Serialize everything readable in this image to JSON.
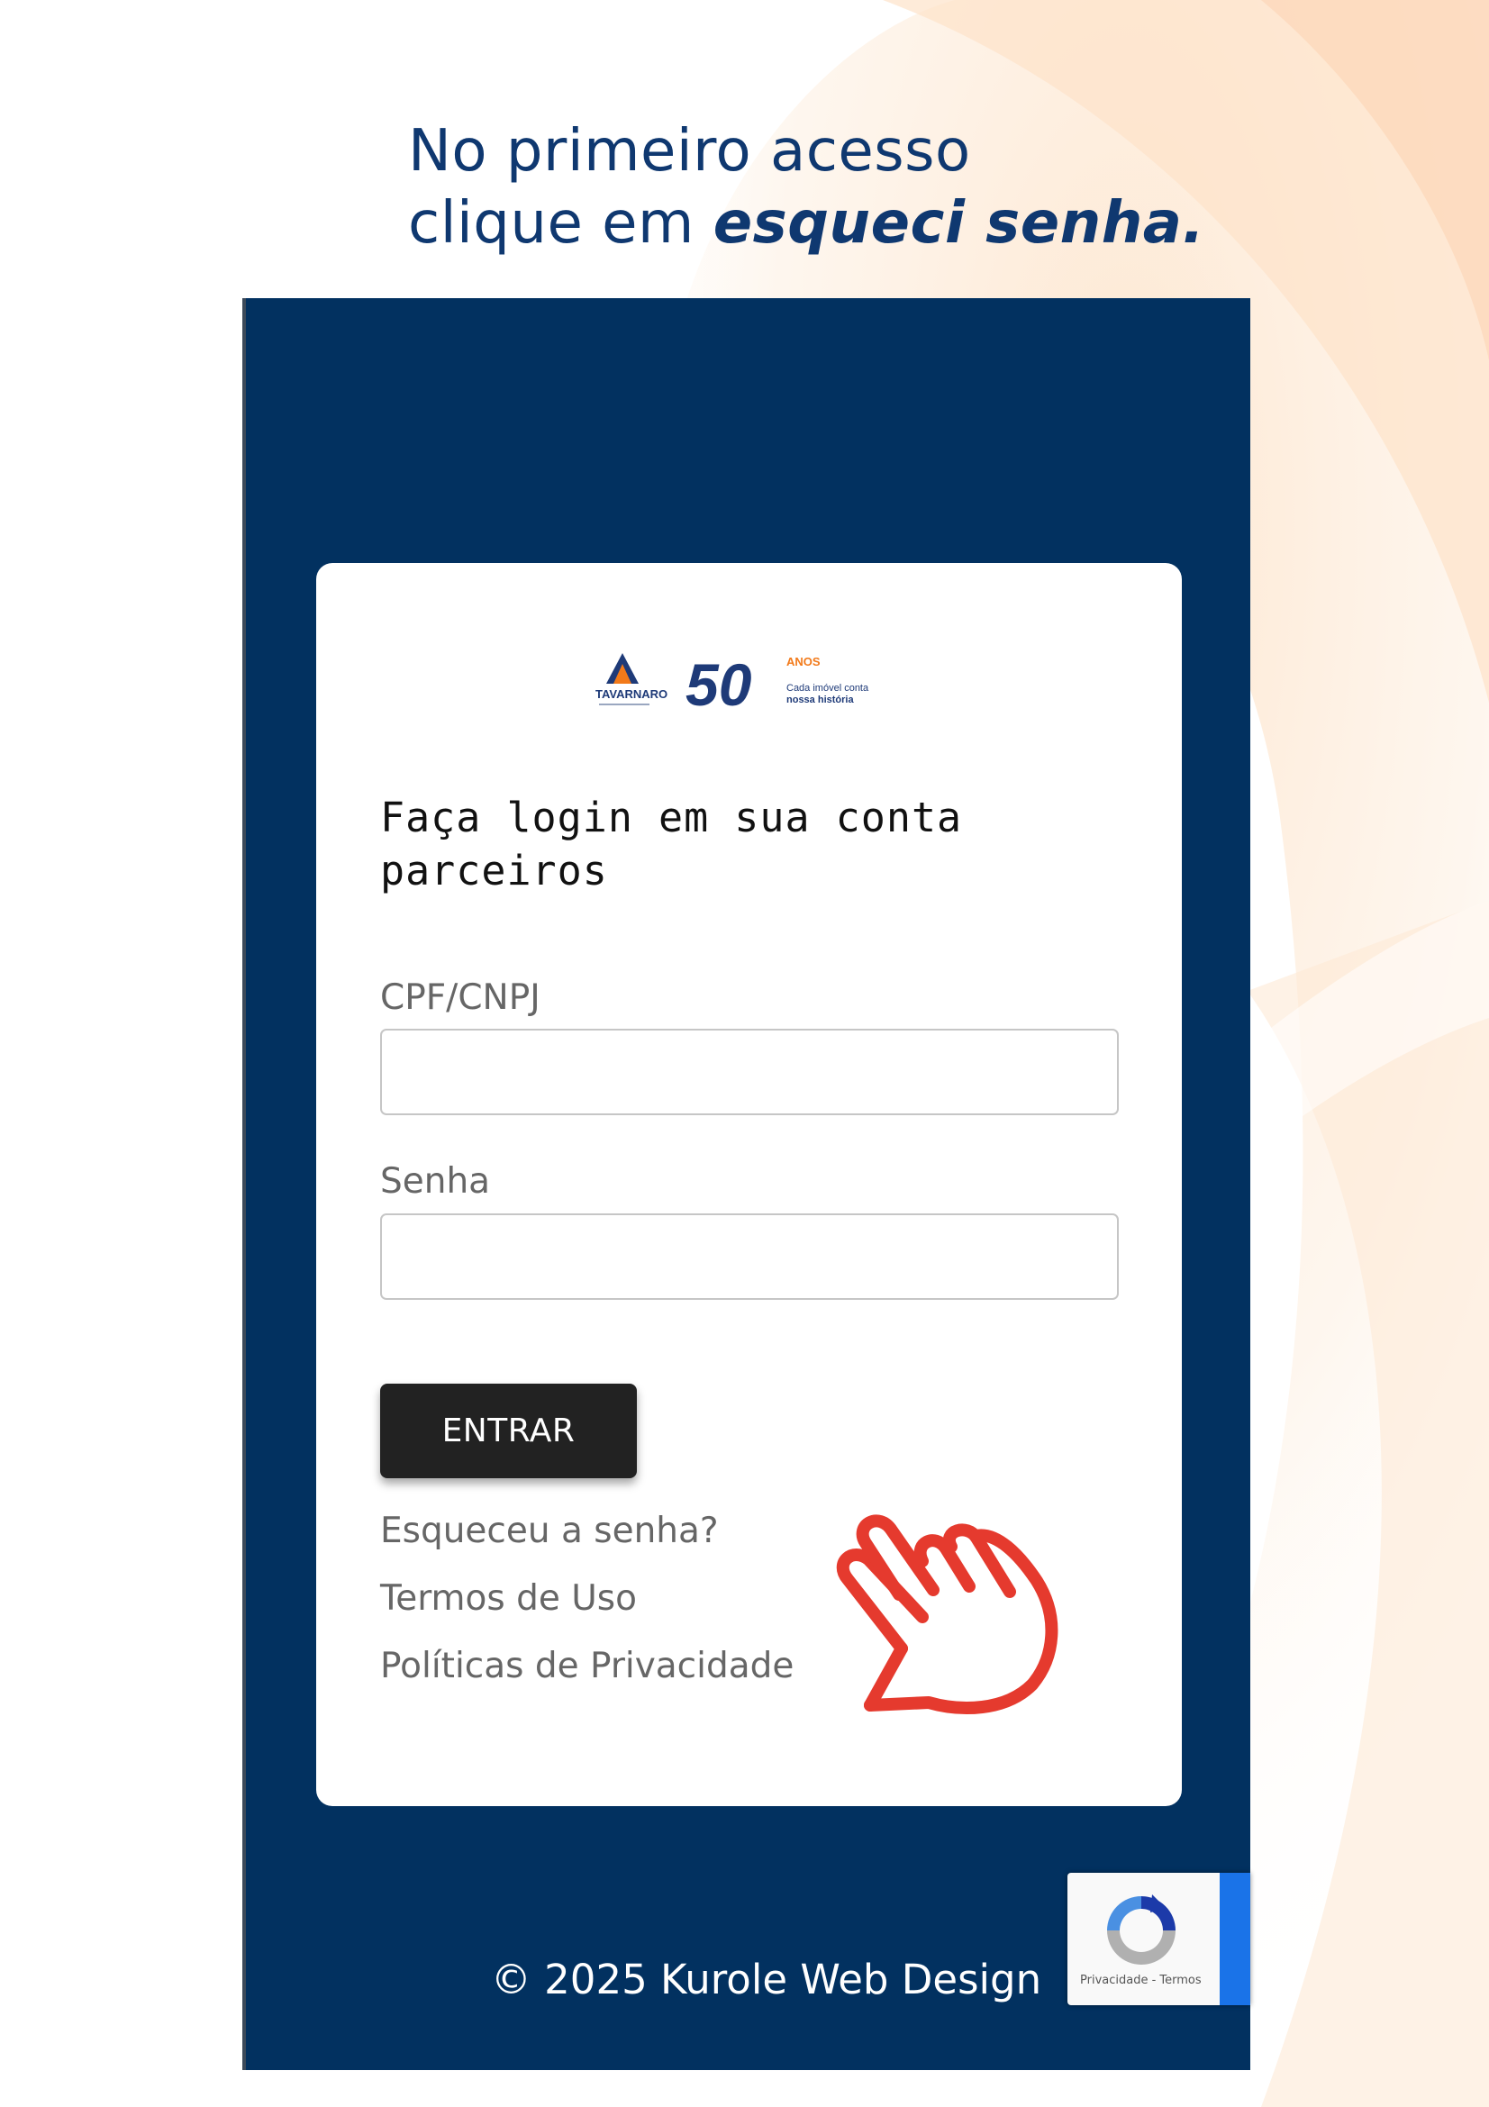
{
  "headline": {
    "line1": "No primeiro acesso",
    "line2_prefix": "clique em ",
    "line2_emphasis": "esqueci senha."
  },
  "logo": {
    "brand": "TAVARNARO",
    "years": "50",
    "anos": "ANOS",
    "tagline_1": "Cada imóvel conta",
    "tagline_2": "nossa história"
  },
  "login": {
    "title": "Faça login em sua conta parceiros",
    "cpf_label": "CPF/CNPJ",
    "cpf_value": "",
    "password_label": "Senha",
    "password_value": "",
    "submit_label": "ENTRAR"
  },
  "links": {
    "forgot_password": "Esqueceu a senha?",
    "terms": "Termos de Uso",
    "privacy": "Políticas de Privacidade"
  },
  "footer": {
    "copyright": "© 2025 Kurole Web Design"
  },
  "recaptcha": {
    "text": "Privacidade - Termos"
  },
  "colors": {
    "navy": "#023160",
    "headline": "#0f3870",
    "logo_orange": "#f27a1a",
    "hand_red": "#e53a2e",
    "button": "#222222"
  },
  "icons": {
    "pointer": "hand-pointer-icon",
    "recaptcha": "recaptcha-icon"
  }
}
